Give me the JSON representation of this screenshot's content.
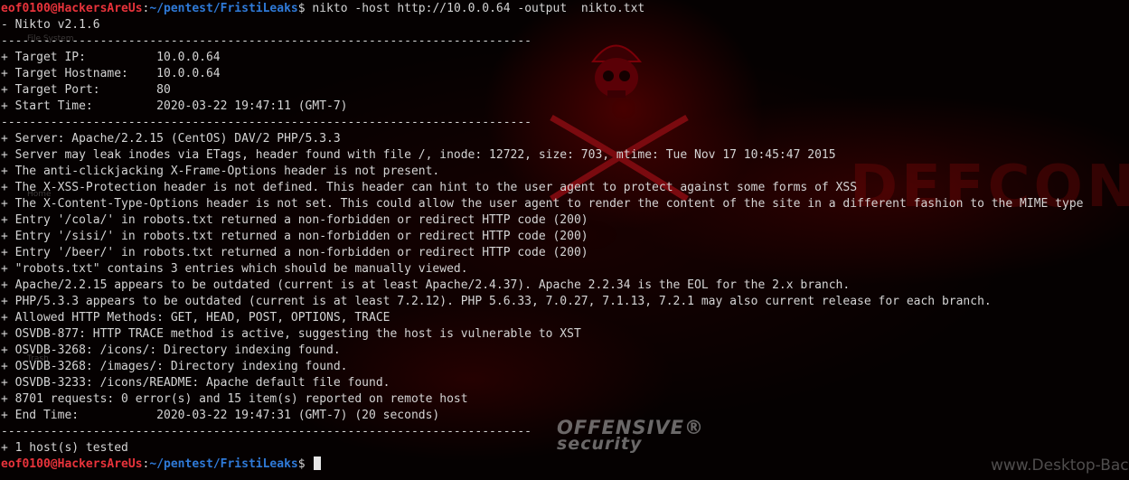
{
  "prompt": {
    "user_host": "eof0100@HackersAreUs",
    "separator": ":",
    "path": "~/pentest/FristiLeaks",
    "symbol": "$"
  },
  "command": " nikto -host http://10.0.0.64 -output  nikto.txt",
  "output_lines": [
    "- Nikto v2.1.6",
    "---------------------------------------------------------------------------",
    "+ Target IP:          10.0.0.64",
    "+ Target Hostname:    10.0.0.64",
    "+ Target Port:        80",
    "+ Start Time:         2020-03-22 19:47:11 (GMT-7)",
    "---------------------------------------------------------------------------",
    "+ Server: Apache/2.2.15 (CentOS) DAV/2 PHP/5.3.3",
    "+ Server may leak inodes via ETags, header found with file /, inode: 12722, size: 703, mtime: Tue Nov 17 10:45:47 2015",
    "+ The anti-clickjacking X-Frame-Options header is not present.",
    "+ The X-XSS-Protection header is not defined. This header can hint to the user agent to protect against some forms of XSS",
    "+ The X-Content-Type-Options header is not set. This could allow the user agent to render the content of the site in a different fashion to the MIME type",
    "+ Entry '/cola/' in robots.txt returned a non-forbidden or redirect HTTP code (200)",
    "+ Entry '/sisi/' in robots.txt returned a non-forbidden or redirect HTTP code (200)",
    "+ Entry '/beer/' in robots.txt returned a non-forbidden or redirect HTTP code (200)",
    "+ \"robots.txt\" contains 3 entries which should be manually viewed.",
    "+ Apache/2.2.15 appears to be outdated (current is at least Apache/2.4.37). Apache 2.2.34 is the EOL for the 2.x branch.",
    "+ PHP/5.3.3 appears to be outdated (current is at least 7.2.12). PHP 5.6.33, 7.0.27, 7.1.13, 7.2.1 may also current release for each branch.",
    "+ Allowed HTTP Methods: GET, HEAD, POST, OPTIONS, TRACE",
    "+ OSVDB-877: HTTP TRACE method is active, suggesting the host is vulnerable to XST",
    "+ OSVDB-3268: /icons/: Directory indexing found.",
    "+ OSVDB-3268: /images/: Directory indexing found.",
    "+ OSVDB-3233: /icons/README: Apache default file found.",
    "+ 8701 requests: 0 error(s) and 15 item(s) reported on remote host",
    "+ End Time:           2020-03-22 19:47:31 (GMT-7) (20 seconds)",
    "---------------------------------------------------------------------------",
    "+ 1 host(s) tested"
  ],
  "wallpaper": {
    "defcon_text": "DEFCON",
    "offsec_line1": "OFFENSIVE®",
    "offsec_line2": "security",
    "watermark": "www.Desktop-Bac",
    "desktop_labels": [
      "File System",
      "Home",
      "Trash"
    ]
  },
  "colors": {
    "prompt_user": "#e8333b",
    "prompt_path": "#2f7ad8",
    "text": "#d4d4d4",
    "background": "#050101"
  },
  "icons": [
    "skull-icon",
    "crossed-swords-icon"
  ]
}
